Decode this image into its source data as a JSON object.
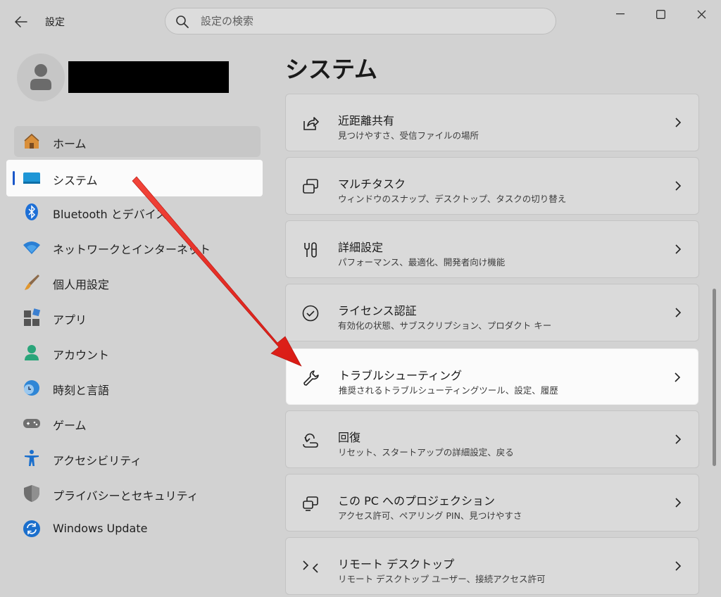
{
  "window": {
    "app_title": "設定",
    "search_placeholder": "設定の検索"
  },
  "sidebar": {
    "items": [
      {
        "label": "ホーム",
        "icon": "home-icon"
      },
      {
        "label": "システム",
        "icon": "system-monitor-icon"
      },
      {
        "label": "Bluetooth とデバイス",
        "icon": "bluetooth-icon"
      },
      {
        "label": "ネットワークとインターネット",
        "icon": "wifi-icon"
      },
      {
        "label": "個人用設定",
        "icon": "paintbrush-icon"
      },
      {
        "label": "アプリ",
        "icon": "apps-icon"
      },
      {
        "label": "アカウント",
        "icon": "account-icon"
      },
      {
        "label": "時刻と言語",
        "icon": "time-language-icon"
      },
      {
        "label": "ゲーム",
        "icon": "gamepad-icon"
      },
      {
        "label": "アクセシビリティ",
        "icon": "accessibility-icon"
      },
      {
        "label": "プライバシーとセキュリティ",
        "icon": "shield-icon"
      },
      {
        "label": "Windows Update",
        "icon": "windows-update-icon"
      }
    ]
  },
  "main": {
    "page_title": "システム",
    "cards": [
      {
        "title": "近距離共有",
        "subtitle": "見つけやすさ、受信ファイルの場所",
        "icon": "share-icon"
      },
      {
        "title": "マルチタスク",
        "subtitle": "ウィンドウのスナップ、デスクトップ、タスクの切り替え",
        "icon": "multitask-icon"
      },
      {
        "title": "詳細設定",
        "subtitle": "パフォーマンス、最適化、開発者向け機能",
        "icon": "advanced-tools-icon"
      },
      {
        "title": "ライセンス認証",
        "subtitle": "有効化の状態、サブスクリプション、プロダクト キー",
        "icon": "check-circle-icon"
      },
      {
        "title": "トラブルシューティング",
        "subtitle": "推奨されるトラブルシューティングツール、設定、履歴",
        "icon": "wrench-icon"
      },
      {
        "title": "回復",
        "subtitle": "リセット、スタートアップの詳細設定、戻る",
        "icon": "recovery-icon"
      },
      {
        "title": "この PC へのプロジェクション",
        "subtitle": "アクセス許可、ペアリング PIN、見つけやすさ",
        "icon": "projection-icon"
      },
      {
        "title": "リモート デスクトップ",
        "subtitle": "リモート デスクトップ ユーザー、接続アクセス許可",
        "icon": "remote-desktop-icon"
      }
    ]
  },
  "colors": {
    "accent": "#1a57c9",
    "annotation_arrow": "#e8211c"
  }
}
